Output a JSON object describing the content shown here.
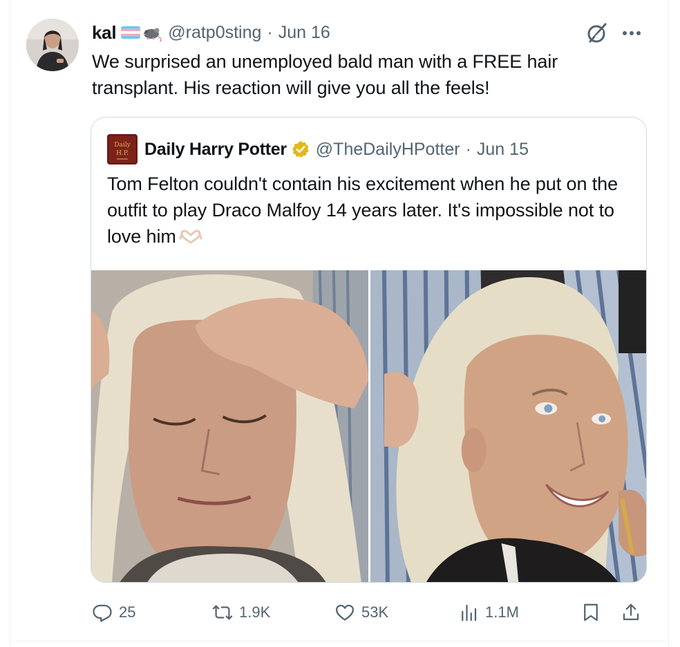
{
  "tweet": {
    "author_name": "kal",
    "handle": "@ratp0sting",
    "separator": "·",
    "date": "Jun 16",
    "text": "We surprised an unemployed bald man with a FREE hair transplant. His reaction will give you all the feels!"
  },
  "quote": {
    "author_name": "Daily Harry Potter",
    "handle": "@TheDailyHPotter",
    "separator": "·",
    "date": "Jun 15",
    "text": "Tom Felton couldn't contain his excitement when he put on the outfit to play Draco Malfoy 14 years later. It's impossible not to love him"
  },
  "actions": {
    "replies": "25",
    "reposts": "1.9K",
    "likes": "53K",
    "views": "1.1M"
  },
  "icons": {
    "reply": "reply-icon",
    "repost": "repost-icon",
    "like": "heart-icon",
    "views": "views-chart-icon",
    "bookmark": "bookmark-icon",
    "share": "share-icon",
    "grok": "grok-icon",
    "more": "more-dots-icon",
    "verified": "verified-badge-icon"
  },
  "colors": {
    "text": "#0f1419",
    "secondary": "#536471",
    "border": "#cfd9de",
    "verified_gold": "#e2b719"
  }
}
